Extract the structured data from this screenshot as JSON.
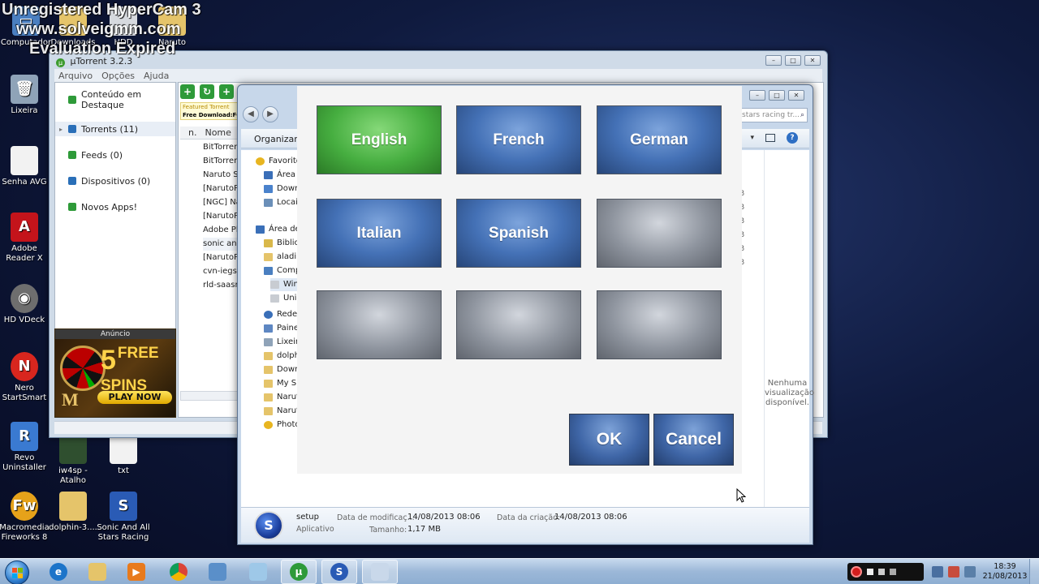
{
  "watermark": {
    "line1": "Unregistered HyperCam 3",
    "line2": "www.solveigmm.com",
    "line3": "Evaluation Expired"
  },
  "desktop": {
    "top_row": [
      "Computador",
      "Downloads",
      "HDD",
      "Naruto"
    ],
    "left_column": [
      {
        "label": "Lixeira",
        "icon": "recycle-bin-icon"
      },
      {
        "label": "Senha AVG",
        "icon": "document-icon"
      },
      {
        "label": "Adobe Reader X",
        "icon": "adobe-reader-icon"
      },
      {
        "label": "HD VDeck",
        "icon": "hd-vdeck-icon"
      },
      {
        "label": "Nero StartSmart",
        "icon": "nero-icon"
      },
      {
        "label": "Revo Uninstaller",
        "icon": "revo-icon"
      },
      {
        "label": "Macromedia Fireworks 8",
        "icon": "fireworks-icon"
      }
    ],
    "bottom_icons": [
      {
        "label": "iw4sp - Atalho",
        "icon": "iw4sp-icon"
      },
      {
        "label": "txt",
        "icon": "text-file-icon"
      },
      {
        "label": "dolphin-3....",
        "icon": "folder-icon"
      },
      {
        "label": "Sonic And All Stars Racing",
        "icon": "sonic-icon"
      }
    ]
  },
  "utorrent": {
    "title": "µTorrent 3.2.3",
    "menu": [
      "Arquivo",
      "Opções",
      "Ajuda"
    ],
    "sidebar": {
      "featured": "Conteúdo em Destaque",
      "torrents": "Torrents (11)",
      "feeds": "Feeds (0)",
      "devices": "Dispositivos (0)",
      "apps": "Novos Apps!"
    },
    "ad": {
      "label": "Anúncio",
      "big": "5",
      "free": "FREE",
      "spins": "SPINS",
      "cta": "PLAY NOW",
      "logo": "M"
    },
    "featured_torrent": {
      "label": "Featured Torrent",
      "text": "Free Download:FC"
    },
    "columns": {
      "n": "n.",
      "name": "Nome"
    },
    "rows": [
      "BitTorrent",
      "BitTorrent",
      "Naruto Sh",
      "[NarutoPl",
      "[NGC] Na",
      "[NarutoPl",
      "Adobe Ph",
      "sonic and",
      "[NarutoPl",
      "cvn-iegs20",
      "rld-saasrt."
    ]
  },
  "explorer": {
    "search_placeholder": "stars racing tr...",
    "organize": "Organizar",
    "nav_items": [
      {
        "label": "Favoritos",
        "icon": "star-icon"
      },
      {
        "label": "Área de",
        "icon": "desktop-icon"
      },
      {
        "label": "Downl",
        "icon": "downloads-icon"
      },
      {
        "label": "Locais",
        "icon": "places-icon"
      },
      {
        "label": "Área de",
        "icon": "desktop-icon"
      },
      {
        "label": "Bibliot",
        "icon": "library-icon"
      },
      {
        "label": "aladim",
        "icon": "user-folder-icon"
      },
      {
        "label": "Comp",
        "icon": "computer-icon"
      },
      {
        "label": "Win7",
        "icon": "drive-icon"
      },
      {
        "label": "Unid",
        "icon": "drive-icon"
      },
      {
        "label": "Rede",
        "icon": "network-icon"
      },
      {
        "label": "Painel",
        "icon": "control-panel-icon"
      },
      {
        "label": "Lixeira",
        "icon": "recycle-bin-icon"
      },
      {
        "label": "dolphi",
        "icon": "folder-icon"
      },
      {
        "label": "Downl",
        "icon": "folder-icon"
      },
      {
        "label": "My Sh",
        "icon": "folder-icon"
      },
      {
        "label": "Naruto",
        "icon": "folder-icon"
      },
      {
        "label": "Naruto",
        "icon": "folder-icon"
      },
      {
        "label": "Photos",
        "icon": "photos-icon"
      }
    ],
    "preview_text": "Nenhuma visualização disponível.",
    "side_letters": [
      "B",
      "B",
      "B",
      "B",
      "B",
      "B"
    ],
    "details": {
      "name": "setup",
      "type": "Aplicativo",
      "modified_label": "Data de modificaç...",
      "modified_value": "14/08/2013 08:06",
      "created_label": "Data da criação:",
      "created_value": "14/08/2013 08:06",
      "size_label": "Tamanho:",
      "size_value": "1,17 MB"
    }
  },
  "language_dialog": {
    "languages": [
      "English",
      "French",
      "German",
      "Italian",
      "Spanish",
      "",
      "",
      "",
      ""
    ],
    "selected": "English",
    "ok": "OK",
    "cancel": "Cancel",
    "colors": {
      "selected": "#46ae40",
      "available": "#4471b6",
      "empty": "#8e949e"
    }
  },
  "taskbar": {
    "apps": [
      {
        "icon": "internet-explorer-icon"
      },
      {
        "icon": "file-explorer-icon"
      },
      {
        "icon": "media-player-icon"
      },
      {
        "icon": "chrome-icon"
      },
      {
        "icon": "app-icon"
      },
      {
        "icon": "window-icon"
      },
      {
        "icon": "utorrent-icon"
      },
      {
        "icon": "sonic-icon"
      },
      {
        "icon": "installer-icon"
      }
    ],
    "time": "18:39",
    "date": "21/08/2013"
  }
}
